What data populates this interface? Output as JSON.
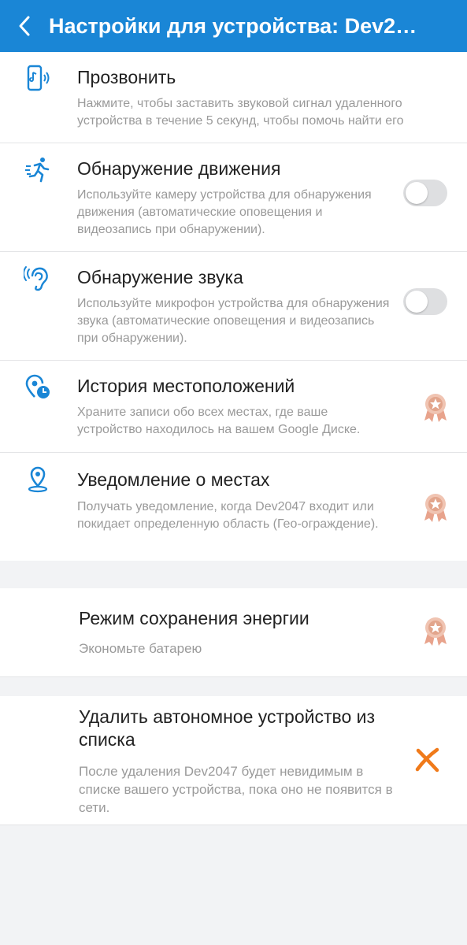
{
  "header": {
    "title": "Настройки для устройства: Dev2…",
    "back_icon": "chevron-left-icon",
    "color": "#1a86d6"
  },
  "settings": [
    {
      "title": "Прозвонить",
      "description": "Нажмите, чтобы заставить звуковой сигнал удаленного устройства в течение 5 секунд, чтобы помочь найти его",
      "icon": "phone-ring-icon",
      "control": "none"
    },
    {
      "title": "Обнаружение движения",
      "description": "Используйте камеру устройства для обнаружения движения (автоматические оповещения и видеозапись при обнаружении).",
      "icon": "running-person-icon",
      "control": "toggle",
      "enabled": false
    },
    {
      "title": "Обнаружение звука",
      "description": "Используйте микрофон устройства для обнаружения звука (автоматические оповещения и видеозапись при обнаружении).",
      "icon": "ear-icon",
      "control": "toggle",
      "enabled": false
    },
    {
      "title": "История местоположений",
      "description": "Храните записи обо всех местах, где ваше устройство находилось на вашем Google Диске.",
      "icon": "location-history-icon",
      "control": "premium-badge"
    },
    {
      "title": "Уведомление о местах",
      "description": "Получать уведомление, когда Dev2047 входит или покидает определенную область (Гео-ограждение).",
      "icon": "location-pin-icon",
      "control": "premium-badge"
    }
  ],
  "power_saving": {
    "title": "Режим сохранения энергии",
    "description": "Экономьте батарею",
    "control": "premium-badge"
  },
  "remove_device": {
    "title": "Удалить автономное устройство из списка",
    "description": "После удаления Dev2047 будет невидимым в списке вашего устройства, пока оно не появится в сети.",
    "icon": "close-x-icon",
    "color": "#f07a1a"
  }
}
